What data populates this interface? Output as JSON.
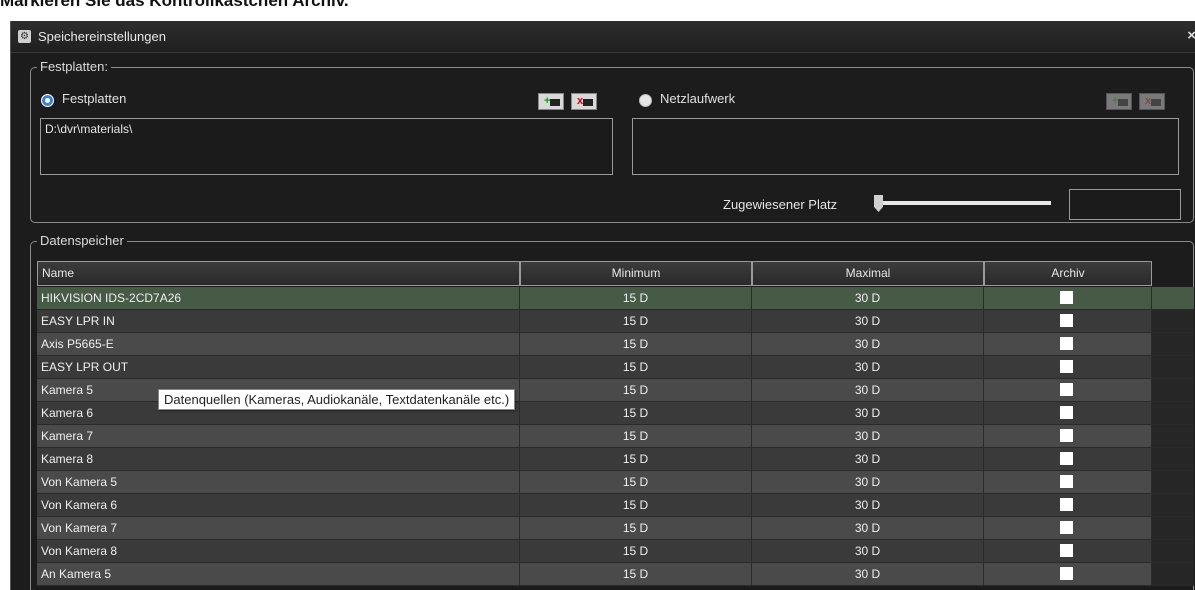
{
  "heading": "Markieren Sie das Kontrollkästchen Archiv.",
  "window": {
    "title": "Speichereinstellungen",
    "close_glyph": "×",
    "icon": "gear-icon"
  },
  "festplatten_group": {
    "label": "Festplatten:",
    "local_radio": {
      "label": "Festplatten",
      "selected": true
    },
    "network_radio": {
      "label": "Netzlaufwerk",
      "selected": false
    },
    "local_paths": [
      "D:\\dvr\\materials\\"
    ],
    "network_paths": [],
    "allocated_label": "Zugewiesener Platz",
    "allocated_value": ""
  },
  "datenspeicher_group": {
    "label": "Datenspeicher",
    "columns": [
      "Name",
      "Minimum",
      "Maximal",
      "Archiv"
    ],
    "rows": [
      {
        "name": "HIKVISION IDS-2CD7A26",
        "min": "15 D",
        "max": "30 D",
        "archiv": false
      },
      {
        "name": "EASY LPR IN",
        "min": "15 D",
        "max": "30 D",
        "archiv": false
      },
      {
        "name": "Axis P5665-E",
        "min": "15 D",
        "max": "30 D",
        "archiv": false
      },
      {
        "name": "EASY LPR OUT",
        "min": "15 D",
        "max": "30 D",
        "archiv": false
      },
      {
        "name": "Kamera 5",
        "min": "15 D",
        "max": "30 D",
        "archiv": false
      },
      {
        "name": "Kamera 6",
        "min": "15 D",
        "max": "30 D",
        "archiv": false
      },
      {
        "name": "Kamera 7",
        "min": "15 D",
        "max": "30 D",
        "archiv": false
      },
      {
        "name": "Kamera 8",
        "min": "15 D",
        "max": "30 D",
        "archiv": false
      },
      {
        "name": "Von Kamera 5",
        "min": "15 D",
        "max": "30 D",
        "archiv": false
      },
      {
        "name": "Von Kamera 6",
        "min": "15 D",
        "max": "30 D",
        "archiv": false
      },
      {
        "name": "Von Kamera 7",
        "min": "15 D",
        "max": "30 D",
        "archiv": false
      },
      {
        "name": "Von Kamera 8",
        "min": "15 D",
        "max": "30 D",
        "archiv": false
      },
      {
        "name": "An Kamera 5",
        "min": "15 D",
        "max": "30 D",
        "archiv": false
      }
    ]
  },
  "tooltip": "Datenquellen (Kameras, Audiokanäle, Textdatenkanäle etc.)",
  "colors": {
    "selected_row": "#465a46",
    "window_bg": "#1c1c1c",
    "radio_accent": "#3c7fd4"
  }
}
